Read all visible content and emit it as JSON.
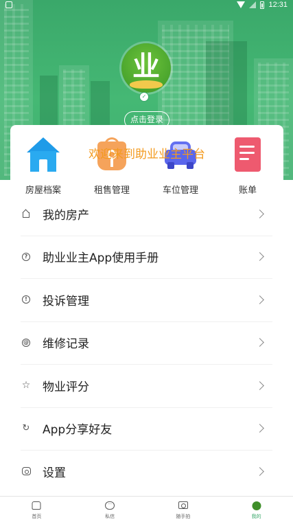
{
  "status_bar": {
    "time": "12:31",
    "icons": [
      "sim-card-icon",
      "wifi-icon",
      "signal-off-icon",
      "battery-icon"
    ]
  },
  "profile": {
    "logo_text": "业",
    "login_button": "点击登录",
    "welcome_text": "欢迎来到助业业主平台"
  },
  "quick_actions": [
    {
      "label": "房屋档案",
      "icon": "house-icon",
      "color": "#2aaaf0"
    },
    {
      "label": "租售管理",
      "icon": "rent-key-icon",
      "color": "#f5a35b"
    },
    {
      "label": "车位管理",
      "icon": "car-icon",
      "color": "#5a66ec"
    },
    {
      "label": "账单",
      "icon": "bill-icon",
      "color": "#ee5a6f"
    }
  ],
  "menu": [
    {
      "label": "我的房产",
      "icon": "home-outline-icon"
    },
    {
      "label": "助业业主App使用手册",
      "icon": "help-circle-icon"
    },
    {
      "label": "投诉管理",
      "icon": "alert-circle-icon"
    },
    {
      "label": "维修记录",
      "icon": "at-circle-icon"
    },
    {
      "label": "物业评分",
      "icon": "star-icon"
    },
    {
      "label": "App分享好友",
      "icon": "share-icon"
    },
    {
      "label": "设置",
      "icon": "settings-icon"
    }
  ],
  "tabs": [
    {
      "label": "首页",
      "icon": "home-tab-icon",
      "active": false
    },
    {
      "label": "私信",
      "icon": "chat-tab-icon",
      "active": false
    },
    {
      "label": "随手拍",
      "icon": "camera-tab-icon",
      "active": false
    },
    {
      "label": "我的",
      "icon": "profile-tab-icon",
      "active": true
    }
  ],
  "colors": {
    "header_green": "#3fb06f",
    "accent_orange": "#f39a1e",
    "active_tab": "#3aa86a"
  }
}
